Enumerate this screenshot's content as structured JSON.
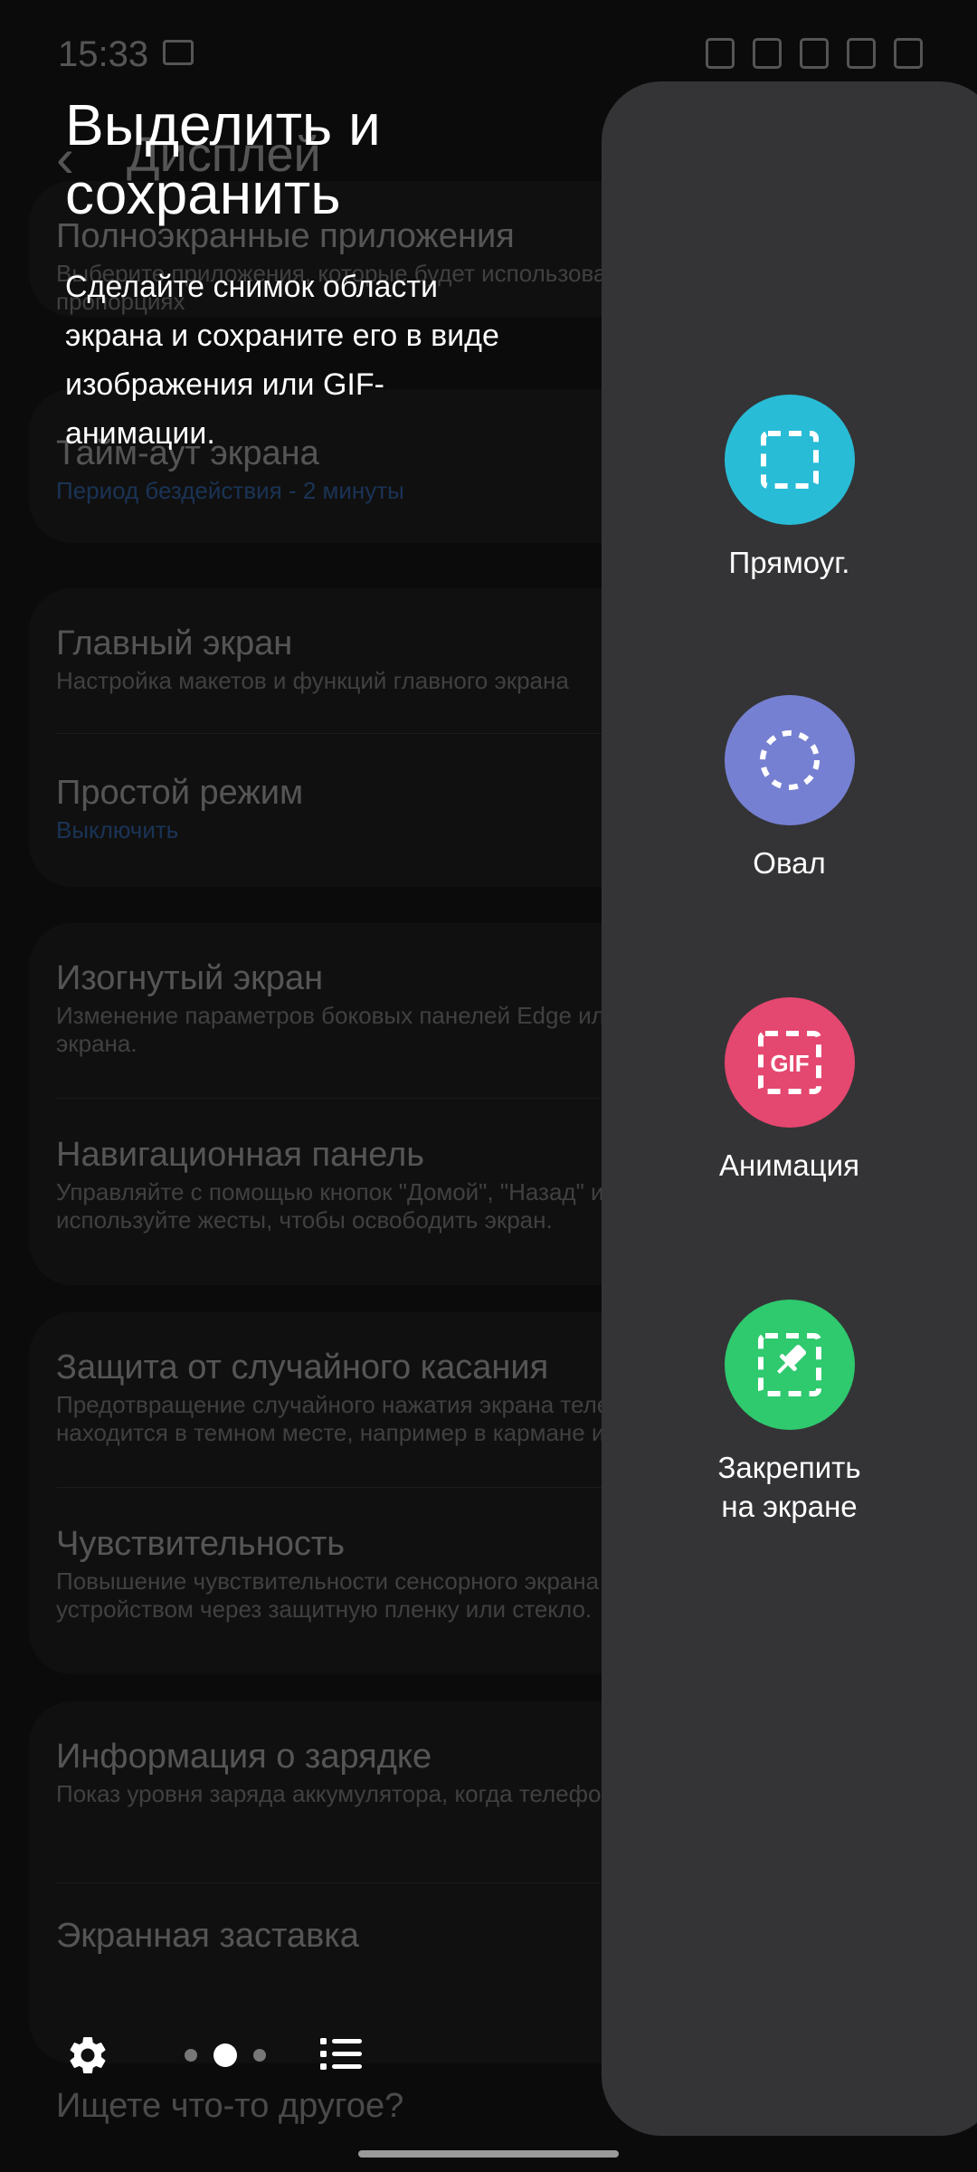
{
  "status_bar": {
    "time": "15:33"
  },
  "background": {
    "header_title": "Дисплей",
    "partial_item_title": "Полноэкранные приложения",
    "partial_item_sub": "Выберите приложения, которые будет использовать в полноэкранных пропорциях",
    "items": [
      {
        "title": "Тайм-аут экрана",
        "sub": "Период бездействия - 2 минуты"
      },
      {
        "title": "Главный экран",
        "sub": "Настройка макетов и функций главного экрана"
      },
      {
        "title": "Простой режим",
        "sub": "Выключить"
      },
      {
        "title": "Изогнутый экран",
        "sub": "Изменение параметров боковых панелей Edge или боковой подсветки экрана."
      },
      {
        "title": "Навигационная панель",
        "sub": "Управляйте с помощью кнопок \"Домой\", \"Назад\" и \"Последние\" или используйте жесты, чтобы освободить экран."
      },
      {
        "title": "Защита от случайного касания",
        "sub": "Предотвращение случайного нажатия экрана телефона, когда он находится в темном месте, например в кармане или сумке."
      },
      {
        "title": "Чувствительность",
        "sub": "Повышение чувствительности сенсорного экрана для управления устройством через защитную пленку или стекло."
      },
      {
        "title": "Информация о зарядке",
        "sub": "Показ уровня заряда аккумулятора, когда телефон не используется."
      },
      {
        "title": "Экранная заставка",
        "sub": ""
      }
    ],
    "bottom_text": "Ищете что-то другое?"
  },
  "overlay": {
    "title": "Выделить и сохранить",
    "description": "Сделайте снимок области экрана и сохраните его в виде изображения или GIF-анимации."
  },
  "tools": [
    {
      "label": "Прямоуг.",
      "icon": "rectangle-select-icon",
      "color": "#29bcd6"
    },
    {
      "label": "Овал",
      "icon": "oval-select-icon",
      "color": "#7680d2"
    },
    {
      "label": "Анимация",
      "icon": "gif-icon",
      "color": "#e4476f",
      "icon_text": "GIF"
    },
    {
      "label": "Закрепить на экране",
      "icon": "pin-to-screen-icon",
      "color": "#2fc96e"
    }
  ],
  "pager": {
    "pages": 3,
    "current": 2
  }
}
